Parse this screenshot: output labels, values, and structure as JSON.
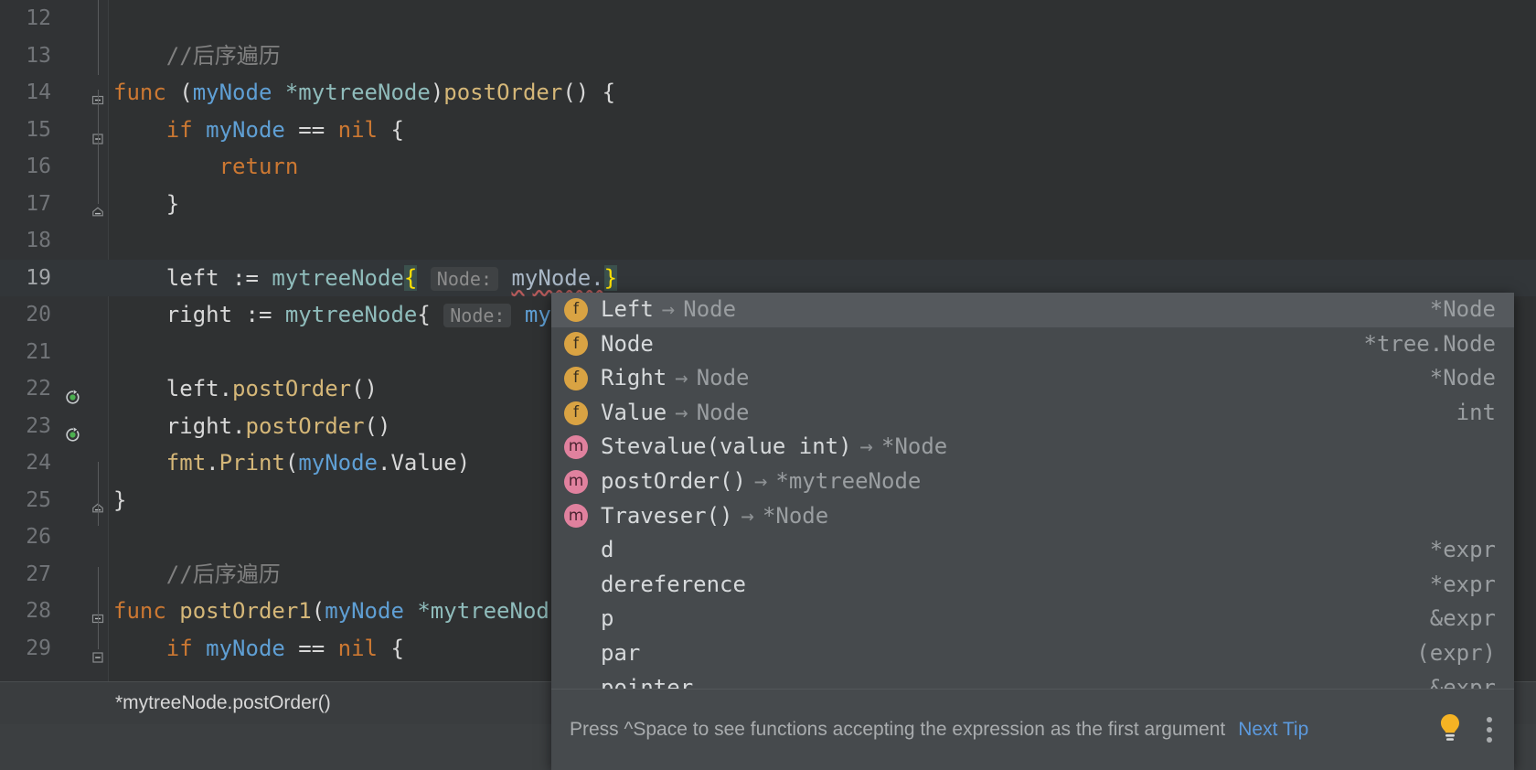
{
  "editor": {
    "language": "Go",
    "colors": {
      "background": "#2f3132",
      "gutter": "#313335",
      "current_line": "#323639",
      "keyword": "#cc7832",
      "function": "#d5b778",
      "type": "#8fbcbb",
      "parameter": "#5f9fd4",
      "comment": "#808080",
      "text": "#a9b7c6",
      "brace_match": "#ffe000",
      "error_underline": "#b55a5a"
    },
    "lines": [
      {
        "number": "12",
        "tokens": []
      },
      {
        "number": "13",
        "tokens": [
          {
            "t": "    ",
            "c": "plain"
          },
          {
            "t": "//后序遍历",
            "c": "cmt"
          }
        ]
      },
      {
        "number": "14",
        "fold": "collapse-top",
        "tokens": [
          {
            "t": "func",
            "c": "kw"
          },
          {
            "t": " (",
            "c": "plain"
          },
          {
            "t": "myNode",
            "c": "param"
          },
          {
            "t": " ",
            "c": "plain"
          },
          {
            "t": "*mytreeNode",
            "c": "typ"
          },
          {
            "t": ")",
            "c": "plain"
          },
          {
            "t": "postOrder",
            "c": "fn"
          },
          {
            "t": "() {",
            "c": "plain"
          }
        ]
      },
      {
        "number": "15",
        "fold": "collapse-mid",
        "tokens": [
          {
            "t": "    ",
            "c": "plain"
          },
          {
            "t": "if",
            "c": "kw"
          },
          {
            "t": " ",
            "c": "plain"
          },
          {
            "t": "myNode",
            "c": "param"
          },
          {
            "t": " == ",
            "c": "plain"
          },
          {
            "t": "nil",
            "c": "kw"
          },
          {
            "t": " {",
            "c": "plain"
          }
        ]
      },
      {
        "number": "16",
        "tokens": [
          {
            "t": "        ",
            "c": "plain"
          },
          {
            "t": "return",
            "c": "kw"
          }
        ]
      },
      {
        "number": "17",
        "fold": "collapse-end",
        "tokens": [
          {
            "t": "    }",
            "c": "plain"
          }
        ]
      },
      {
        "number": "18",
        "tokens": []
      },
      {
        "number": "19",
        "current": true,
        "tokens": [
          {
            "t": "    ",
            "c": "plain"
          },
          {
            "t": "left",
            "c": "plain"
          },
          {
            "t": " := ",
            "c": "plain"
          },
          {
            "t": "mytreeNode",
            "c": "typ"
          },
          {
            "t": "{",
            "c": "brace-hl"
          },
          {
            "t": " ",
            "c": "plain"
          },
          {
            "t": "Node:",
            "c": "inlay"
          },
          {
            "t": " ",
            "c": "plain"
          },
          {
            "t": "myNode.",
            "c": "err"
          },
          {
            "t": "}",
            "c": "brace-hl"
          }
        ]
      },
      {
        "number": "20",
        "tokens": [
          {
            "t": "    ",
            "c": "plain"
          },
          {
            "t": "right",
            "c": "plain"
          },
          {
            "t": " := ",
            "c": "plain"
          },
          {
            "t": "mytreeNode",
            "c": "typ"
          },
          {
            "t": "{",
            "c": "plain"
          },
          {
            "t": " ",
            "c": "plain"
          },
          {
            "t": "Node:",
            "c": "inlay"
          },
          {
            "t": " ",
            "c": "plain"
          },
          {
            "t": "myN",
            "c": "param"
          }
        ]
      },
      {
        "number": "21",
        "tokens": []
      },
      {
        "number": "22",
        "runmark": "recursion-marker",
        "tokens": [
          {
            "t": "    left",
            "c": "plain"
          },
          {
            "t": ".",
            "c": "plain"
          },
          {
            "t": "postOrder",
            "c": "fn"
          },
          {
            "t": "()",
            "c": "plain"
          }
        ]
      },
      {
        "number": "23",
        "runmark": "recursion-marker",
        "tokens": [
          {
            "t": "    right",
            "c": "plain"
          },
          {
            "t": ".",
            "c": "plain"
          },
          {
            "t": "postOrder",
            "c": "fn"
          },
          {
            "t": "()",
            "c": "plain"
          }
        ]
      },
      {
        "number": "24",
        "tokens": [
          {
            "t": "    ",
            "c": "plain"
          },
          {
            "t": "fmt",
            "c": "fn"
          },
          {
            "t": ".",
            "c": "plain"
          },
          {
            "t": "Print",
            "c": "fn"
          },
          {
            "t": "(",
            "c": "plain"
          },
          {
            "t": "myNode",
            "c": "param"
          },
          {
            "t": ".Value)",
            "c": "plain"
          }
        ]
      },
      {
        "number": "25",
        "fold": "collapse-end",
        "tokens": [
          {
            "t": "}",
            "c": "plain"
          }
        ]
      },
      {
        "number": "26",
        "tokens": []
      },
      {
        "number": "27",
        "tokens": [
          {
            "t": "    ",
            "c": "plain"
          },
          {
            "t": "//后序遍历",
            "c": "cmt"
          }
        ]
      },
      {
        "number": "28",
        "fold": "collapse-top",
        "tokens": [
          {
            "t": "func",
            "c": "kw"
          },
          {
            "t": " ",
            "c": "plain"
          },
          {
            "t": "postOrder1",
            "c": "fn"
          },
          {
            "t": "(",
            "c": "plain"
          },
          {
            "t": "myNode",
            "c": "param"
          },
          {
            "t": " ",
            "c": "plain"
          },
          {
            "t": "*mytreeNod",
            "c": "typ"
          }
        ]
      },
      {
        "number": "29",
        "fold": "collapse-mid",
        "tokens": [
          {
            "t": "    ",
            "c": "plain"
          },
          {
            "t": "if",
            "c": "kw"
          },
          {
            "t": " ",
            "c": "plain"
          },
          {
            "t": "myNode",
            "c": "param"
          },
          {
            "t": " == ",
            "c": "plain"
          },
          {
            "t": "nil",
            "c": "kw"
          },
          {
            "t": " {",
            "c": "plain"
          }
        ]
      }
    ]
  },
  "breadcrumb": {
    "text": "*mytreeNode.postOrder()"
  },
  "completion_popup": {
    "selected_index": 0,
    "rows": [
      {
        "icon": "f",
        "label": "Left",
        "arrow": "→",
        "tail": "Node",
        "type": "*Node"
      },
      {
        "icon": "f",
        "label": "Node",
        "arrow": "",
        "tail": "",
        "type": "*tree.Node"
      },
      {
        "icon": "f",
        "label": "Right",
        "arrow": "→",
        "tail": "Node",
        "type": "*Node"
      },
      {
        "icon": "f",
        "label": "Value",
        "arrow": "→",
        "tail": "Node",
        "type": "int"
      },
      {
        "icon": "m",
        "label": "Stevalue(value int)",
        "arrow": "→",
        "tail": "*Node",
        "type": ""
      },
      {
        "icon": "m",
        "label": "postOrder()",
        "arrow": "→",
        "tail": "*mytreeNode",
        "type": ""
      },
      {
        "icon": "m",
        "label": "Traveser()",
        "arrow": "→",
        "tail": "*Node",
        "type": ""
      },
      {
        "icon": "none",
        "label": "d",
        "arrow": "",
        "tail": "",
        "type": "*expr"
      },
      {
        "icon": "none",
        "label": "dereference",
        "arrow": "",
        "tail": "",
        "type": "*expr"
      },
      {
        "icon": "none",
        "label": "p",
        "arrow": "",
        "tail": "",
        "type": "&expr"
      },
      {
        "icon": "none",
        "label": "par",
        "arrow": "",
        "tail": "",
        "type": "(expr)"
      },
      {
        "icon": "none",
        "label": "pointer",
        "arrow": "",
        "tail": "",
        "type": "&expr"
      }
    ],
    "hint": {
      "message": "Press ^Space to see functions accepting the expression as the first argument",
      "link": "Next Tip",
      "bulb_icon": "lightbulb-icon",
      "menu_icon": "kebab-menu-icon"
    }
  }
}
